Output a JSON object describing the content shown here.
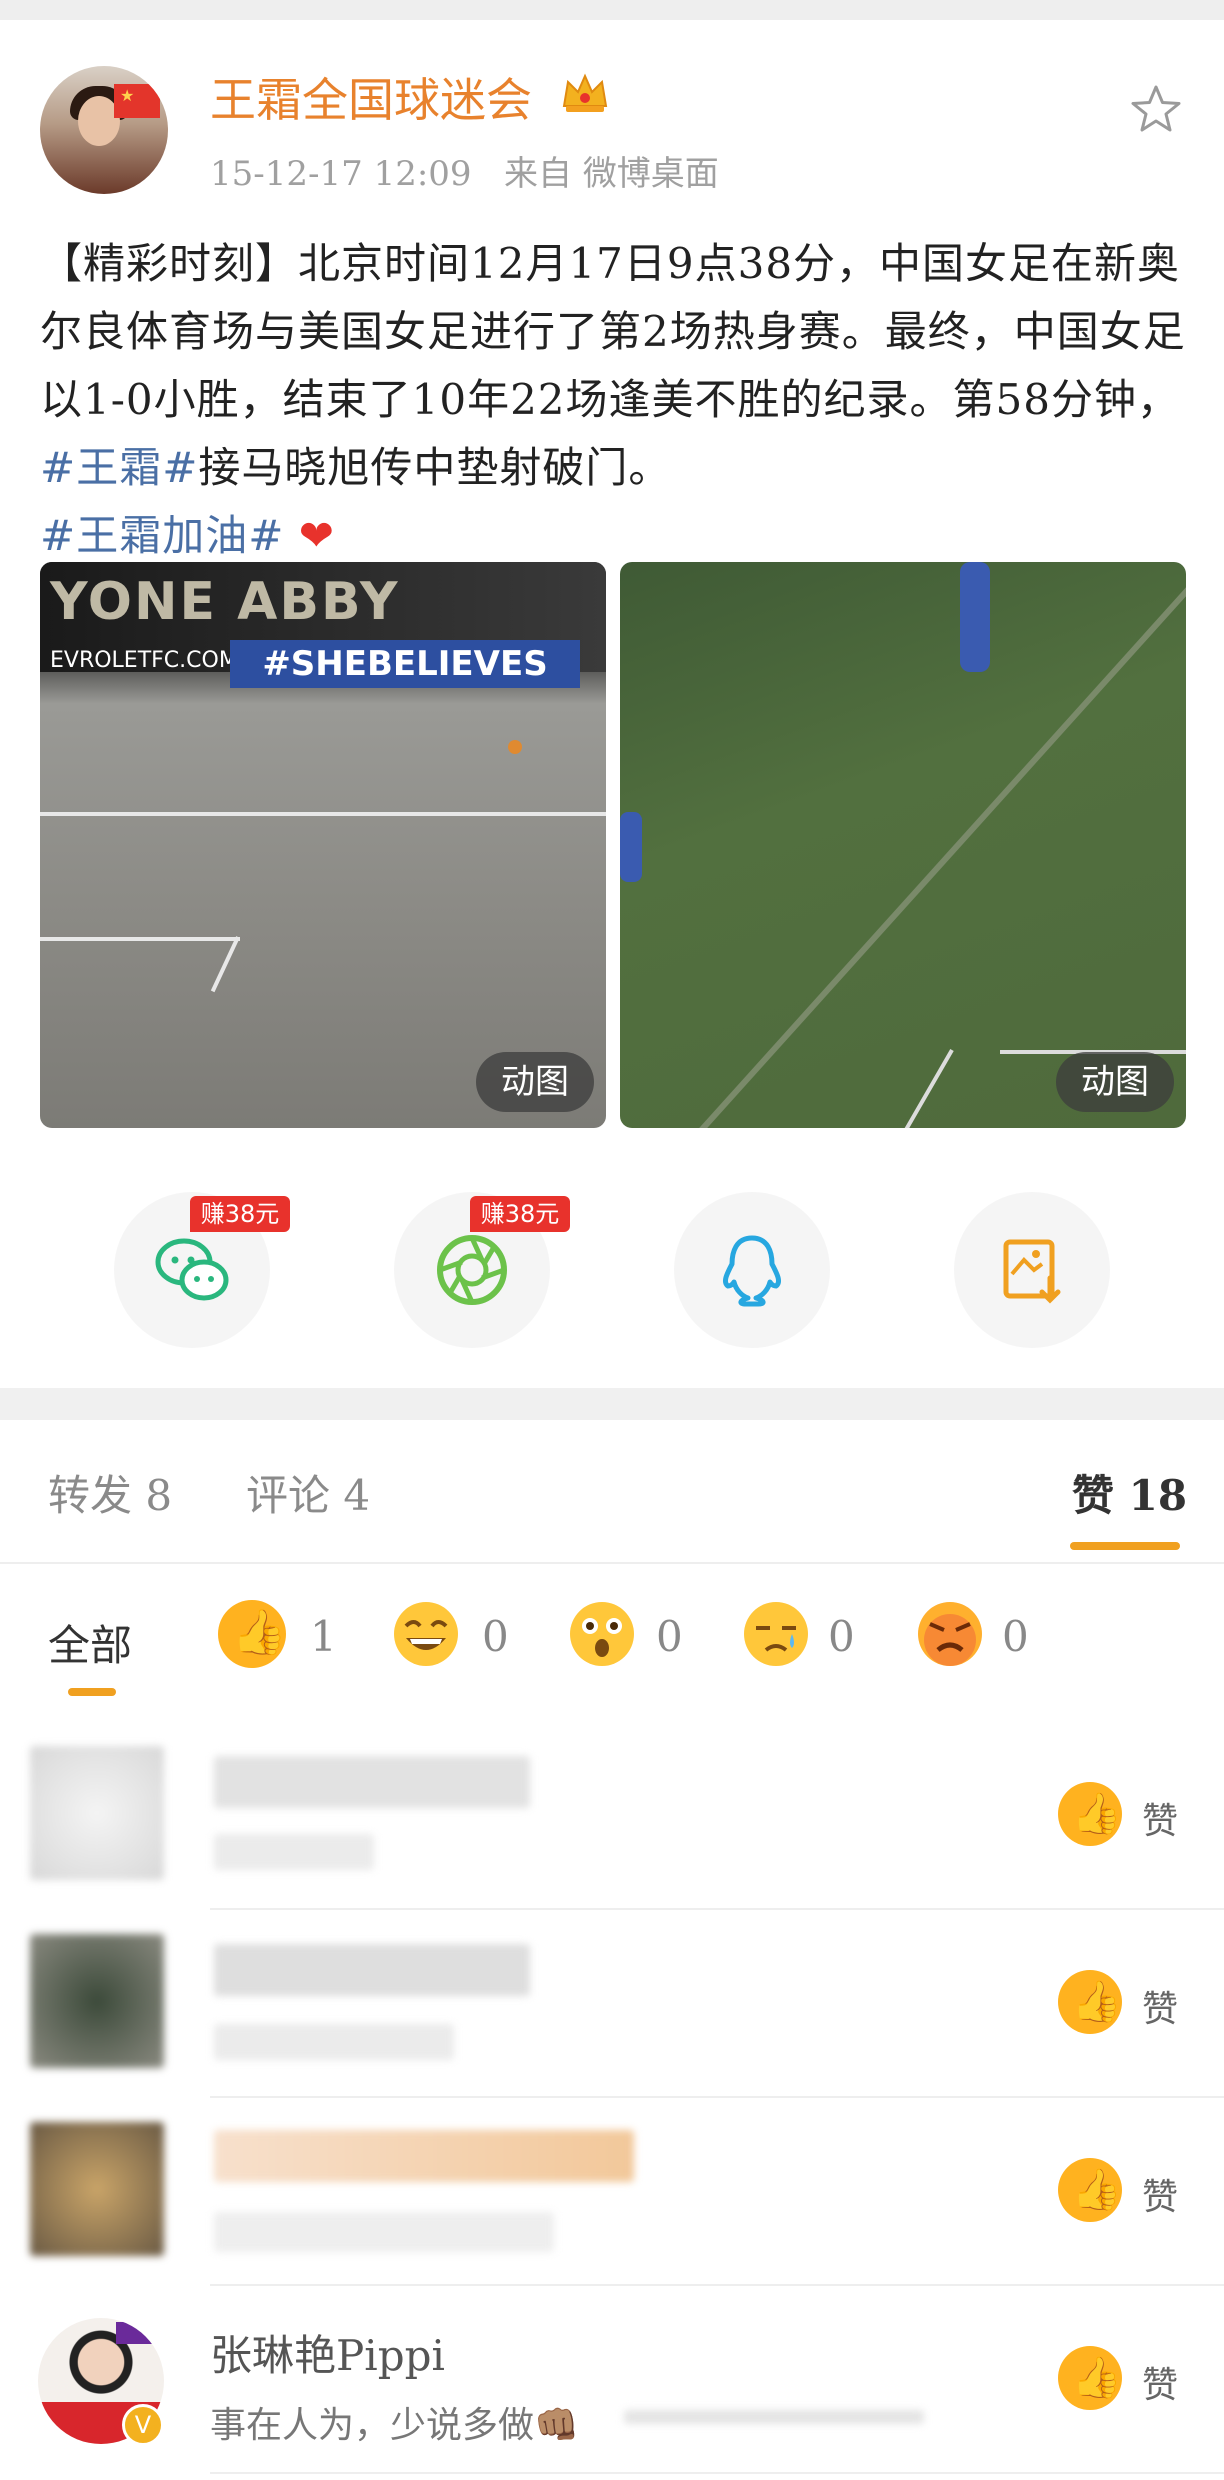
{
  "post": {
    "author": "王霜全国球迷会",
    "time": "15-12-17 12:09",
    "source_prefix": "来自",
    "source": "微博桌面",
    "text_parts": {
      "p1": "【精彩时刻】北京时间12月17日9点38分，中国女足在新奥尔良体育场与美国女足进行了第2场热身赛。最终，中国女足以1-0小胜，结束了10年22场逢美不胜的纪录。第58分钟，",
      "tag1": "#王霜#",
      "p2": "接马晓旭传中垫射破门。",
      "tag2": "#王霜加油#",
      "heart": "❤"
    },
    "images": [
      {
        "banner_text": "YONE ABBY",
        "ad_text": "#SHEBELIEVES",
        "small_text": "EVROLETFC.COM",
        "badge": "动图"
      },
      {
        "badge": "动图"
      }
    ]
  },
  "share": {
    "wechat_reward": "赚38元",
    "moments_reward": "赚38元",
    "icons": [
      "wechat-icon",
      "moments-icon",
      "qq-icon",
      "save-image-icon"
    ]
  },
  "tabs": {
    "repost": "转发 8",
    "comment": "评论 4",
    "like": "赞 18"
  },
  "reactions": {
    "all": "全部",
    "items": [
      {
        "icon": "thumbs-up",
        "count": "1"
      },
      {
        "icon": "grin",
        "count": "0"
      },
      {
        "icon": "surprised",
        "count": "0"
      },
      {
        "icon": "sad",
        "count": "0"
      },
      {
        "icon": "angry",
        "count": "0"
      }
    ]
  },
  "likers": [
    {
      "like_label": "赞"
    },
    {
      "like_label": "赞"
    },
    {
      "like_label": "赞"
    },
    {
      "name": "张琳艳Pippi",
      "bio": "事在人为，少说多做👊🏽",
      "like_label": "赞"
    }
  ],
  "colors": {
    "accent": "#f0a020",
    "username": "#e8822d",
    "hashtag": "#4a6fa5",
    "reward": "#e8322c"
  }
}
